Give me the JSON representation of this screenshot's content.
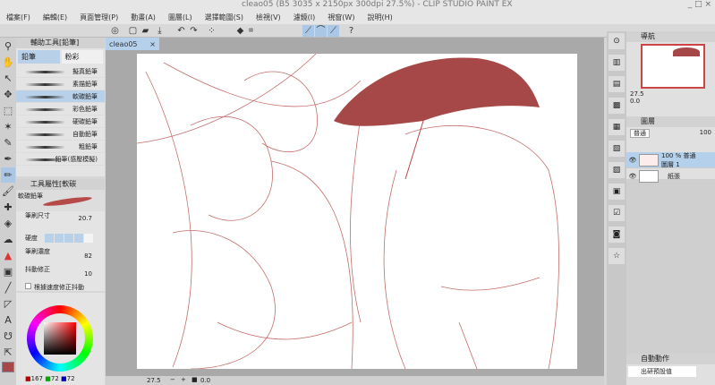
{
  "window": {
    "title": "cleao05 (B5 3035 x 2150px 300dpi 27.5%)  - CLIP STUDIO PAINT EX",
    "controls": "_ □ ×"
  },
  "menu": [
    "檔案(F)",
    "編輯(E)",
    "頁面管理(P)",
    "動畫(A)",
    "圖層(L)",
    "選擇範圍(S)",
    "檢視(V)",
    "濾鏡(I)",
    "視窗(W)",
    "說明(H)"
  ],
  "sub_tool": {
    "title": "輔助工具[鉛筆]",
    "tabs": [
      "鉛筆",
      "粉彩"
    ],
    "brushes": [
      "擬真鉛筆",
      "素描鉛筆",
      "軟碳鉛筆",
      "彩色鉛筆",
      "硬碳鉛筆",
      "自動鉛筆",
      "粗鉛筆",
      "鉛筆(感壓模擬)"
    ],
    "selected": 2
  },
  "tool_property": {
    "title": "工具屬性[軟碳",
    "brush_name": "軟碳鉛筆",
    "brush_size_label": "筆刷尺寸",
    "brush_size": "20.7",
    "hardness_label": "硬度",
    "hardness_level": 4,
    "density_label": "筆刷濃度",
    "density": "82",
    "stabilizer_label": "抖動修正",
    "stabilizer": "10",
    "speed_label": "根據速度修正抖動"
  },
  "color": {
    "main": "#a74848",
    "sub": "#333333",
    "r": "167",
    "g": "72",
    "b": "72"
  },
  "canvas": {
    "tab": "cleao05",
    "zoom": "27.5",
    "angle": "0.0",
    "ink": "#b54a48"
  },
  "navigator": {
    "title": "導航",
    "zoom": "27.5",
    "angle": "0.0"
  },
  "layers": {
    "title": "圖層",
    "blend": "普通",
    "opacity": "100",
    "items": [
      {
        "line1": "100 % 普通",
        "line2": "圖層 1"
      },
      {
        "line1": "",
        "line2": "紙張"
      }
    ]
  },
  "auto_action": {
    "title": "自動動作",
    "set": "出研預設值"
  }
}
